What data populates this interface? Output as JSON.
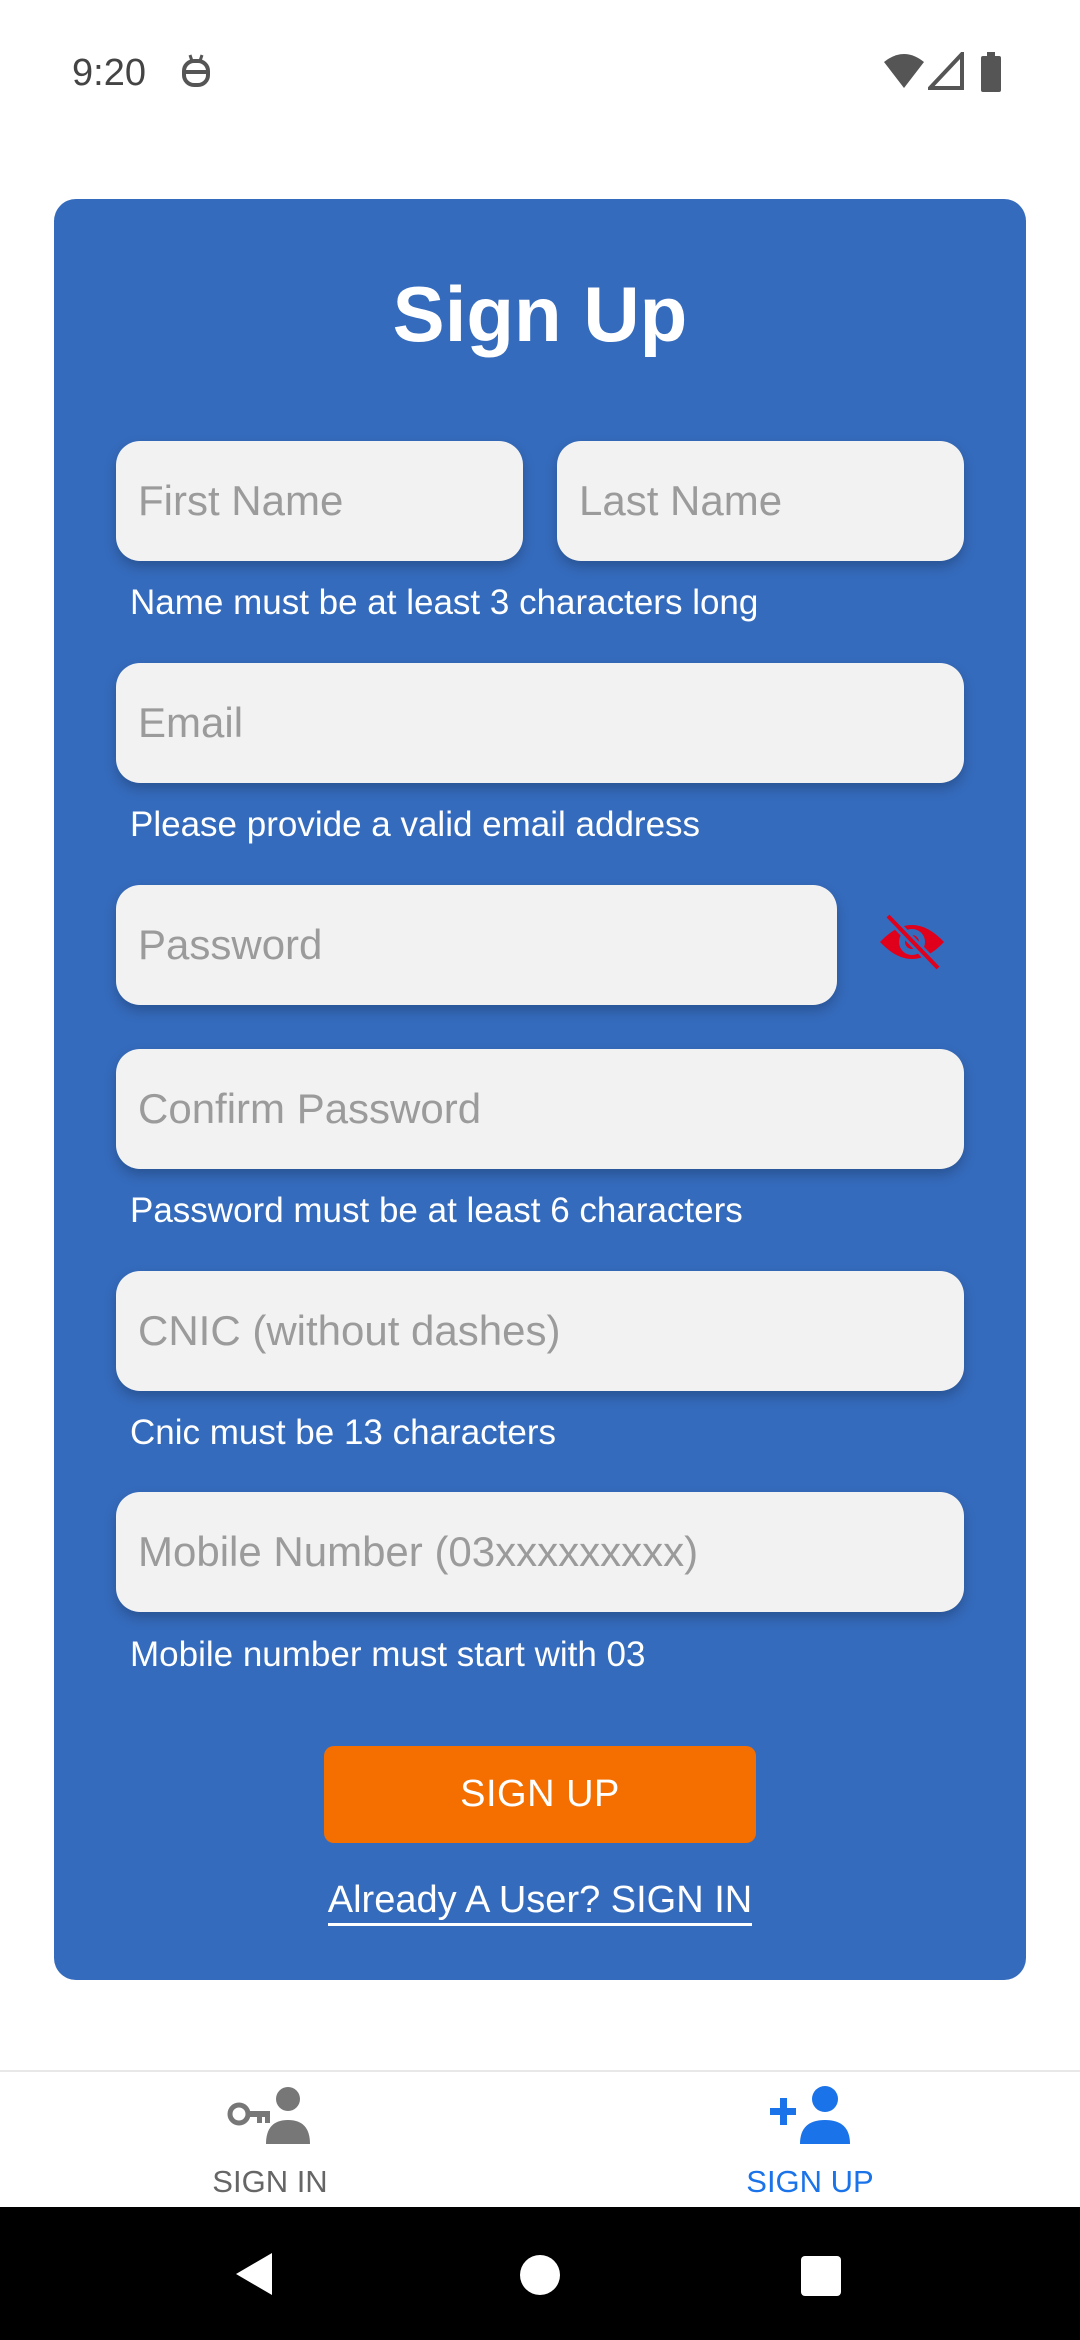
{
  "status_bar": {
    "time": "9:20",
    "icons": [
      "notification-robot-icon",
      "wifi-icon",
      "signal-icon",
      "battery-icon"
    ]
  },
  "form": {
    "title": "Sign Up",
    "first_name_placeholder": "First Name",
    "last_name_placeholder": "Last Name",
    "name_helper": "Name must be at least 3 characters long",
    "email_placeholder": "Email",
    "email_helper": "Please provide a valid email address",
    "password_placeholder": "Password",
    "confirm_password_placeholder": "Confirm Password",
    "password_helper": "Password must be at least 6 characters",
    "cnic_placeholder": "CNIC (without dashes)",
    "cnic_helper": "Cnic must be 13 characters",
    "mobile_placeholder": "Mobile Number (03xxxxxxxxx)",
    "mobile_helper": "Mobile number must start with 03",
    "signup_button": "SIGN UP",
    "signin_link": "Already A User? SIGN IN"
  },
  "bottom_nav": {
    "items": [
      {
        "label": "SIGN IN",
        "icon": "key-person-icon",
        "active": false
      },
      {
        "label": "SIGN UP",
        "icon": "add-person-icon",
        "active": true
      }
    ]
  },
  "colors": {
    "card": "#356bbd",
    "button": "#f46f00",
    "active_tab": "#1a73e8",
    "inactive_tab": "#666666",
    "eye_icon": "#e0001b"
  }
}
